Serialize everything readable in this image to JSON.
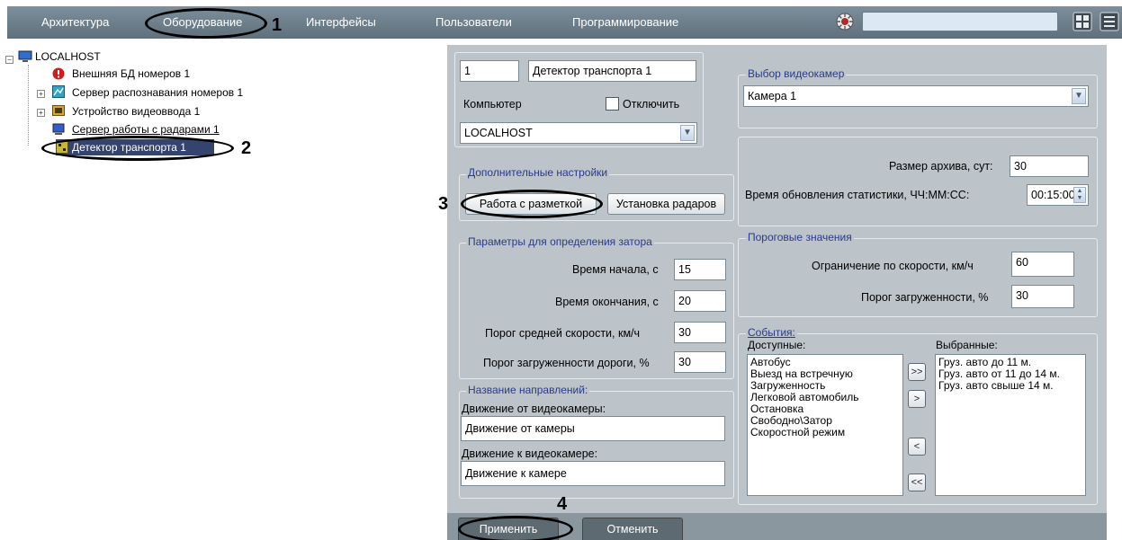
{
  "nav": {
    "tabs": [
      "Архитектура",
      "Оборудование",
      "Интерфейсы",
      "Пользователи",
      "Программирование"
    ],
    "search_value": ""
  },
  "annotations": [
    "1",
    "2",
    "3",
    "4"
  ],
  "tree": {
    "root": "LOCALHOST",
    "items": [
      "Внешняя БД номеров 1",
      "Сервер распознавания номеров 1",
      "Устройство видеоввода 1",
      "Сервер работы с радарами 1",
      "Детектор транспорта 1"
    ]
  },
  "object": {
    "id": "1",
    "name": "Детектор транспорта 1",
    "computer_label": "Компьютер",
    "disable_label": "Отключить",
    "computer_value": "LOCALHOST"
  },
  "camera": {
    "title": "Выбор видеокамер",
    "value": "Камера 1"
  },
  "archive": {
    "size_label": "Размер архива, сут:",
    "size_value": "30",
    "update_label": "Время обновления статистики, ЧЧ:ММ:СС:",
    "update_value": "00:15:00"
  },
  "extra": {
    "title": "Дополнительные настройки",
    "markup_button": "Работа с разметкой",
    "radar_button": "Установка радаров"
  },
  "thresholds": {
    "title": "Пороговые значения",
    "speed_label": "Ограничение по скорости, км/ч",
    "speed_value": "60",
    "load_label": "Порог загруженности, %",
    "load_value": "30"
  },
  "jam": {
    "title": "Параметры для определения затора",
    "start_label": "Время начала, с",
    "start_value": "15",
    "end_label": "Время окончания, с",
    "end_value": "20",
    "avg_speed_label": "Порог средней скорости, км/ч",
    "avg_speed_value": "30",
    "road_load_label": "Порог загруженности дороги, %",
    "road_load_value": "30"
  },
  "directions": {
    "title": "Название направлений:",
    "from_label": "Движение от видеокамеры:",
    "from_value": "Движение от камеры",
    "to_label": "Движение к видеокамере:",
    "to_value": "Движение к камере"
  },
  "events": {
    "title": "События:",
    "available_label": "Доступные:",
    "selected_label": "Выбранные:",
    "available": [
      "Автобус",
      "Выезд на встречную",
      "Загруженность",
      "Легковой автомобиль",
      "Остановка",
      "Свободно\\Затор",
      "Скоростной режим"
    ],
    "selected": [
      "Груз. авто до 11 м.",
      "Груз. авто от 11 до 14 м.",
      "Груз. авто свыше 14 м."
    ],
    "btn_all_right": ">>",
    "btn_right": ">",
    "btn_left": "<",
    "btn_all_left": "<<"
  },
  "actions": {
    "apply": "Применить",
    "cancel": "Отменить"
  }
}
